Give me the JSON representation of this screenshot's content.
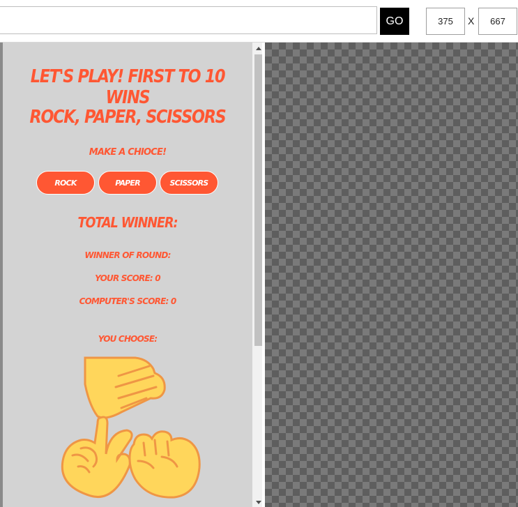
{
  "toolbar": {
    "url_value": "",
    "go_label": "GO",
    "width_value": "375",
    "separator": "X",
    "height_value": "667"
  },
  "game": {
    "headline": "Let's Play! First to 10 wins",
    "title": "Rock, Paper, Scissors",
    "prompt": "Make a chioce!",
    "choices": [
      "Rock",
      "Paper",
      "Scissors"
    ],
    "total_winner_label": "Total Winner:",
    "round_winner_label": "Winner of round:",
    "your_score_text": "Your score: 0",
    "computer_score_text": "Computer's score: 0",
    "you_choose_label": "You choose:"
  },
  "images": {
    "hands": "rock-paper-scissors-hands-icon"
  },
  "colors": {
    "accent": "#ff5733",
    "page_background": "#d3d3d3",
    "hand_fill": "#ffd65b",
    "hand_outline": "#ef9645"
  }
}
